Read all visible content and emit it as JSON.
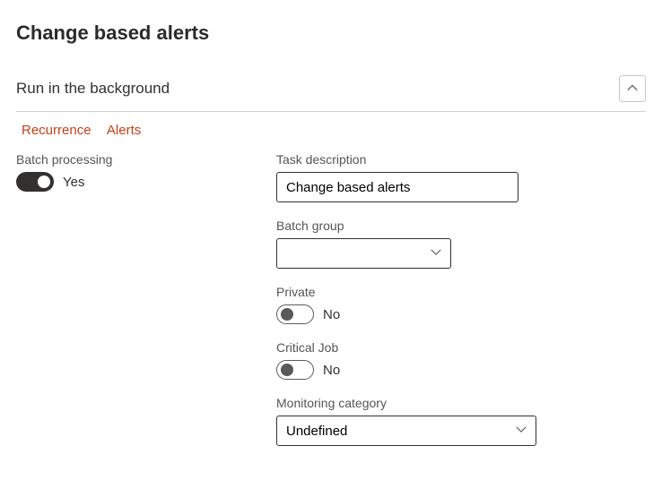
{
  "page": {
    "title": "Change based alerts"
  },
  "section": {
    "title": "Run in the background"
  },
  "links": {
    "recurrence": "Recurrence",
    "alerts": "Alerts"
  },
  "left": {
    "batch_processing_label": "Batch processing",
    "batch_processing_value": "Yes"
  },
  "right": {
    "task_desc_label": "Task description",
    "task_desc_value": "Change based alerts",
    "batch_group_label": "Batch group",
    "batch_group_value": "",
    "private_label": "Private",
    "private_value": "No",
    "critical_label": "Critical Job",
    "critical_value": "No",
    "monitoring_label": "Monitoring category",
    "monitoring_value": "Undefined"
  }
}
